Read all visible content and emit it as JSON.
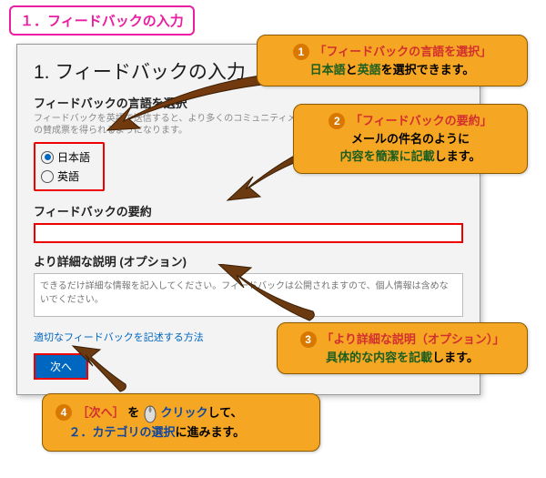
{
  "title_box": "１．フィードバックの入力",
  "window": {
    "title": "1. フィードバックの入力",
    "lang_label": "フィードバックの言語を選択",
    "lang_desc": "フィードバックを英語で送信すると、より多くのコミュニティメンバーが閲覧することができ、より多くの賛成票を得られるようになります。",
    "radio_jp": "日本語",
    "radio_en": "英語",
    "summary_label": "フィードバックの要約",
    "detail_label": "より詳細な説明 (オプション)",
    "detail_placeholder": "できるだけ詳細な情報を記入してください。フィードバックは公開されますので、個人情報は含めないでください。",
    "link": "適切なフィードバックを記述する方法",
    "next": "次へ"
  },
  "callouts": {
    "c1": {
      "num": "1",
      "l1a": "「フィードバックの言語を選択」",
      "l2a": "日本語",
      "l2b": "と",
      "l2c": "英語",
      "l2d": "を選択できます。"
    },
    "c2": {
      "num": "2",
      "l1a": "「フィードバックの要約」",
      "l2a": "メールの件名のように",
      "l3a": "内容を簡潔に記載",
      "l3b": "します。"
    },
    "c3": {
      "num": "3",
      "l1a": "「より詳細な説明（オプション）」",
      "l2a": "具体的な内容を記載",
      "l2b": "します。"
    },
    "c4": {
      "num": "4",
      "l1a": "［次へ］",
      "l1b": "を",
      "l1c": "クリック",
      "l1d": "して、",
      "l2a": "２．カテゴリの選択",
      "l2b": "に進みます。"
    }
  }
}
